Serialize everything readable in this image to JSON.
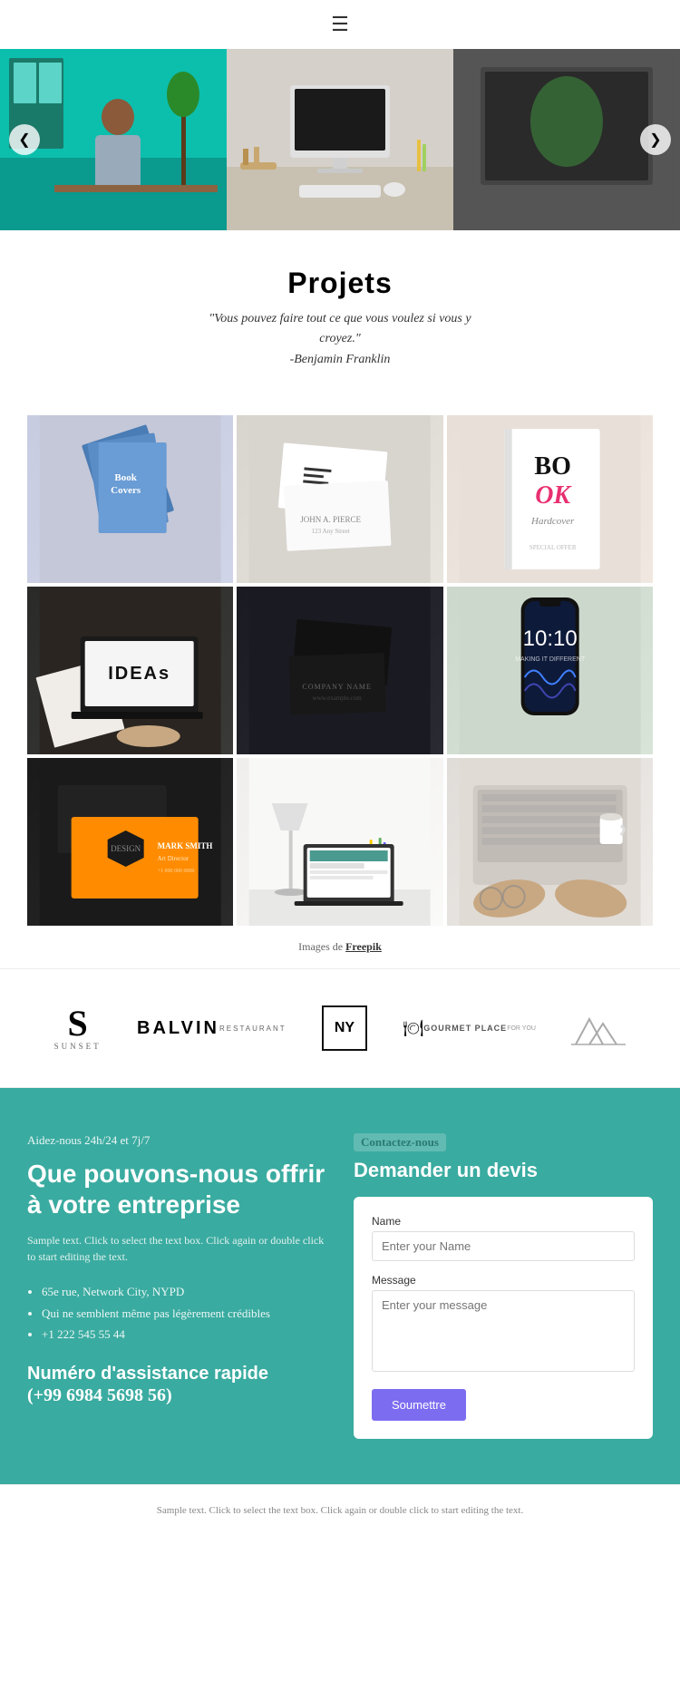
{
  "nav": {
    "hamburger_icon": "☰"
  },
  "carousel": {
    "prev_label": "❮",
    "next_label": "❯"
  },
  "projects": {
    "title": "Projets",
    "quote_line1": "\"Vous pouvez faire tout ce que vous voulez si vous y",
    "quote_line2": "croyez.\"",
    "quote_author": "-Benjamin Franklin",
    "images_credit_prefix": "Images de ",
    "images_credit_link": "Freepik"
  },
  "logos": {
    "sunset": {
      "letter": "S",
      "name": "SUNSET"
    },
    "balvin": {
      "main": "BALVIN",
      "sub": "RESTAURANT"
    },
    "ny": "NY",
    "gourmet": {
      "main": "GOURMET PLACE",
      "sub": "FOR YOU"
    },
    "mountain": "ᗰᗰ"
  },
  "contact": {
    "help_text": "Aidez-nous 24h/24 et 7j/7",
    "heading": "Que pouvons-nous offrir à votre entreprise",
    "description": "Sample text. Click to select the text box. Click again or double click to start editing the text.",
    "list_items": [
      "65e rue, Network City, NYPD",
      "Qui ne semblent même pas légèrement crédibles",
      "+1 222 545 55 44"
    ],
    "hotline_title": "Numéro d'assistance rapide",
    "phone": "(+99 6984 5698 56)",
    "right_label": "Contactez-nous",
    "right_title": "Demander un devis",
    "form": {
      "name_label": "Name",
      "name_placeholder": "Enter your Name",
      "message_label": "Message",
      "message_placeholder": "Enter your message",
      "submit_label": "Soumettre"
    }
  },
  "footer": {
    "text": "Sample text. Click to select the text box. Click again or double click to start editing the text."
  },
  "grid": {
    "ideas_text": "IDEAs",
    "phone_time": "10:10",
    "phone_date": "MAKING IT DIFFERENT"
  }
}
